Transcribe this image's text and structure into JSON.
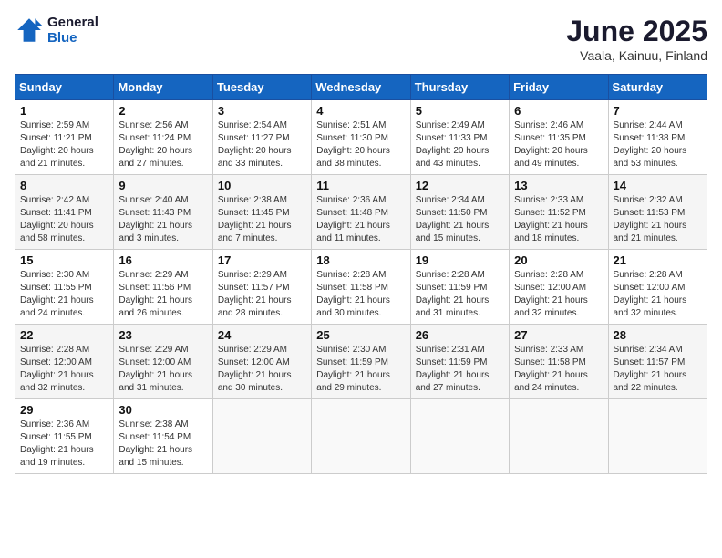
{
  "header": {
    "logo_general": "General",
    "logo_blue": "Blue",
    "month_title": "June 2025",
    "location": "Vaala, Kainuu, Finland"
  },
  "days_of_week": [
    "Sunday",
    "Monday",
    "Tuesday",
    "Wednesday",
    "Thursday",
    "Friday",
    "Saturday"
  ],
  "weeks": [
    [
      {
        "day": "1",
        "sunrise": "2:59 AM",
        "sunset": "11:21 PM",
        "daylight": "20 hours and 21 minutes."
      },
      {
        "day": "2",
        "sunrise": "2:56 AM",
        "sunset": "11:24 PM",
        "daylight": "20 hours and 27 minutes."
      },
      {
        "day": "3",
        "sunrise": "2:54 AM",
        "sunset": "11:27 PM",
        "daylight": "20 hours and 33 minutes."
      },
      {
        "day": "4",
        "sunrise": "2:51 AM",
        "sunset": "11:30 PM",
        "daylight": "20 hours and 38 minutes."
      },
      {
        "day": "5",
        "sunrise": "2:49 AM",
        "sunset": "11:33 PM",
        "daylight": "20 hours and 43 minutes."
      },
      {
        "day": "6",
        "sunrise": "2:46 AM",
        "sunset": "11:35 PM",
        "daylight": "20 hours and 49 minutes."
      },
      {
        "day": "7",
        "sunrise": "2:44 AM",
        "sunset": "11:38 PM",
        "daylight": "20 hours and 53 minutes."
      }
    ],
    [
      {
        "day": "8",
        "sunrise": "2:42 AM",
        "sunset": "11:41 PM",
        "daylight": "20 hours and 58 minutes."
      },
      {
        "day": "9",
        "sunrise": "2:40 AM",
        "sunset": "11:43 PM",
        "daylight": "21 hours and 3 minutes."
      },
      {
        "day": "10",
        "sunrise": "2:38 AM",
        "sunset": "11:45 PM",
        "daylight": "21 hours and 7 minutes."
      },
      {
        "day": "11",
        "sunrise": "2:36 AM",
        "sunset": "11:48 PM",
        "daylight": "21 hours and 11 minutes."
      },
      {
        "day": "12",
        "sunrise": "2:34 AM",
        "sunset": "11:50 PM",
        "daylight": "21 hours and 15 minutes."
      },
      {
        "day": "13",
        "sunrise": "2:33 AM",
        "sunset": "11:52 PM",
        "daylight": "21 hours and 18 minutes."
      },
      {
        "day": "14",
        "sunrise": "2:32 AM",
        "sunset": "11:53 PM",
        "daylight": "21 hours and 21 minutes."
      }
    ],
    [
      {
        "day": "15",
        "sunrise": "2:30 AM",
        "sunset": "11:55 PM",
        "daylight": "21 hours and 24 minutes."
      },
      {
        "day": "16",
        "sunrise": "2:29 AM",
        "sunset": "11:56 PM",
        "daylight": "21 hours and 26 minutes."
      },
      {
        "day": "17",
        "sunrise": "2:29 AM",
        "sunset": "11:57 PM",
        "daylight": "21 hours and 28 minutes."
      },
      {
        "day": "18",
        "sunrise": "2:28 AM",
        "sunset": "11:58 PM",
        "daylight": "21 hours and 30 minutes."
      },
      {
        "day": "19",
        "sunrise": "2:28 AM",
        "sunset": "11:59 PM",
        "daylight": "21 hours and 31 minutes."
      },
      {
        "day": "20",
        "sunrise": "2:28 AM",
        "sunset": "12:00 AM",
        "daylight": "21 hours and 32 minutes."
      },
      {
        "day": "21",
        "sunrise": "2:28 AM",
        "sunset": "12:00 AM",
        "daylight": "21 hours and 32 minutes."
      }
    ],
    [
      {
        "day": "22",
        "sunrise": "2:28 AM",
        "sunset": "12:00 AM",
        "daylight": "21 hours and 32 minutes."
      },
      {
        "day": "23",
        "sunrise": "2:29 AM",
        "sunset": "12:00 AM",
        "daylight": "21 hours and 31 minutes."
      },
      {
        "day": "24",
        "sunrise": "2:29 AM",
        "sunset": "12:00 AM",
        "daylight": "21 hours and 30 minutes."
      },
      {
        "day": "25",
        "sunrise": "2:30 AM",
        "sunset": "11:59 PM",
        "daylight": "21 hours and 29 minutes."
      },
      {
        "day": "26",
        "sunrise": "2:31 AM",
        "sunset": "11:59 PM",
        "daylight": "21 hours and 27 minutes."
      },
      {
        "day": "27",
        "sunrise": "2:33 AM",
        "sunset": "11:58 PM",
        "daylight": "21 hours and 24 minutes."
      },
      {
        "day": "28",
        "sunrise": "2:34 AM",
        "sunset": "11:57 PM",
        "daylight": "21 hours and 22 minutes."
      }
    ],
    [
      {
        "day": "29",
        "sunrise": "2:36 AM",
        "sunset": "11:55 PM",
        "daylight": "21 hours and 19 minutes."
      },
      {
        "day": "30",
        "sunrise": "2:38 AM",
        "sunset": "11:54 PM",
        "daylight": "21 hours and 15 minutes."
      },
      null,
      null,
      null,
      null,
      null
    ]
  ],
  "labels": {
    "sunrise": "Sunrise: ",
    "sunset": "Sunset: ",
    "daylight": "Daylight: "
  }
}
